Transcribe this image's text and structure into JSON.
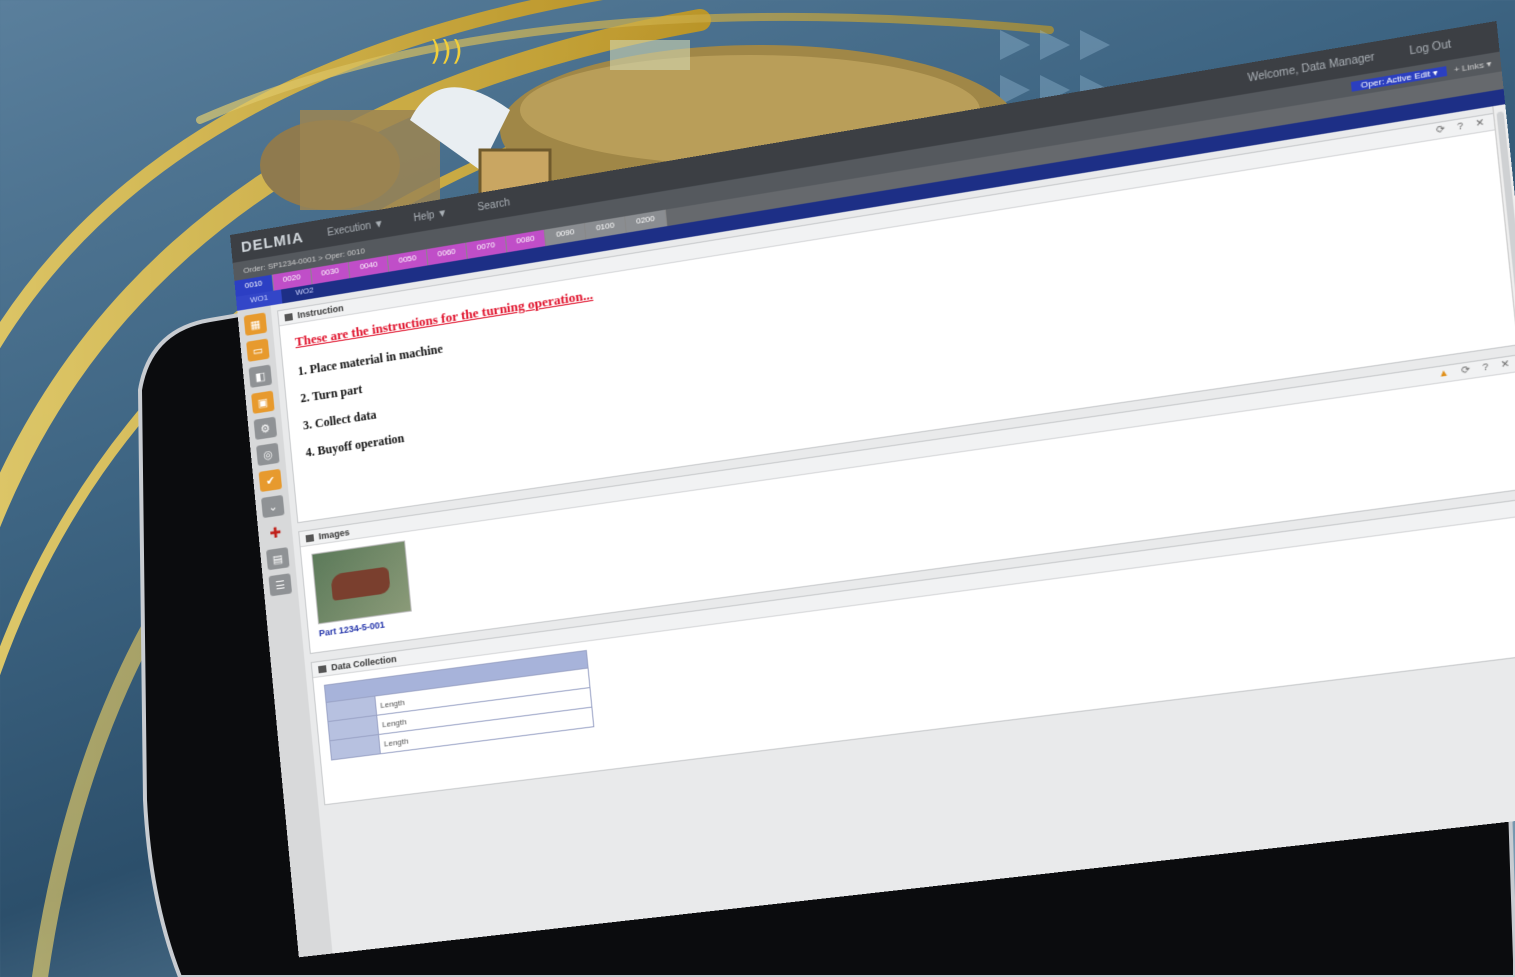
{
  "app": {
    "logo_text": "DELMIA",
    "breadcrumb": "Order: SP1234-0001 > Oper: 0010",
    "menus": [
      "Execution ▼",
      "Help ▼",
      "Search"
    ],
    "welcome": "Welcome, Data Manager",
    "logout": "Log Out",
    "links": "+ Links ▾",
    "status_button": "Oper: Active Edit ▾"
  },
  "tabs": [
    {
      "label": "0010",
      "style": "blue"
    },
    {
      "label": "0020",
      "style": "mag"
    },
    {
      "label": "0030",
      "style": "mag"
    },
    {
      "label": "0040",
      "style": "mag"
    },
    {
      "label": "0050",
      "style": "mag"
    },
    {
      "label": "0060",
      "style": "mag"
    },
    {
      "label": "0070",
      "style": "mag"
    },
    {
      "label": "0080",
      "style": "mag"
    },
    {
      "label": "0090",
      "style": "gray"
    },
    {
      "label": "0100",
      "style": "gray"
    },
    {
      "label": "0200",
      "style": "gray"
    }
  ],
  "subtabs": [
    "WO1",
    "WO2"
  ],
  "panels": {
    "instruction": {
      "header": "Instruction",
      "title": "These are the instructions for the turning operation...",
      "steps": [
        "1. Place material in machine",
        "2. Turn part",
        "3. Collect data",
        "4. Buyoff operation"
      ]
    },
    "images": {
      "header": "Images",
      "caption": "Part 1234-5-001"
    },
    "data_collection": {
      "header": "Data Collection",
      "rows": [
        "Length",
        "Length",
        "Length"
      ]
    }
  },
  "panel_controls": "⟳ ? ✕",
  "panel_controls_warn": "▲",
  "left_tools": [
    {
      "icon": "grid-icon",
      "color": "orange"
    },
    {
      "icon": "window-icon",
      "color": "orange"
    },
    {
      "icon": "doc-icon",
      "color": "gray"
    },
    {
      "icon": "monitor-icon",
      "color": "orange"
    },
    {
      "icon": "gear-icon",
      "color": "gray"
    },
    {
      "icon": "target-icon",
      "color": "gray"
    },
    {
      "icon": "check-icon",
      "color": "orange"
    },
    {
      "icon": "chevron-down-icon",
      "color": "gray"
    },
    {
      "icon": "cross-icon",
      "color": "red"
    },
    {
      "icon": "image-icon",
      "color": "gray"
    },
    {
      "icon": "list-icon",
      "color": "gray"
    }
  ],
  "colors": {
    "accent_blue": "#1d2f86",
    "tab_magenta": "#c04ec8",
    "tool_orange": "#e79a2e",
    "instruction_red": "#e0102a"
  }
}
